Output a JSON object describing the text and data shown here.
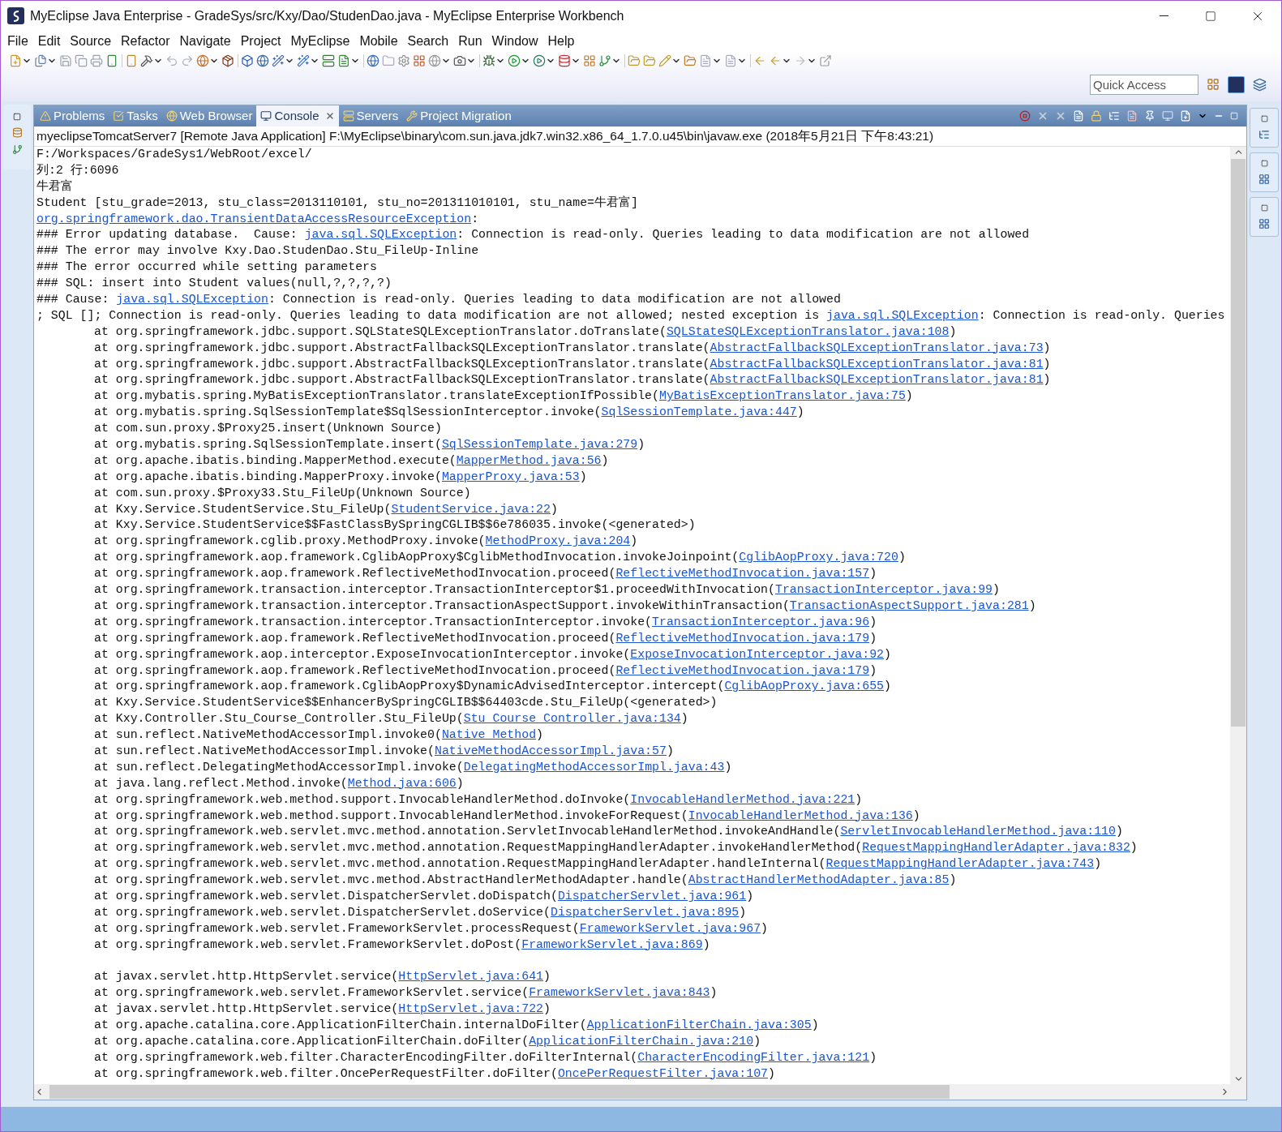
{
  "window": {
    "title": "MyEclipse Java Enterprise - GradeSys/src/Kxy/Dao/StudenDao.java - MyEclipse Enterprise Workbench"
  },
  "menu": [
    "File",
    "Edit",
    "Source",
    "Refactor",
    "Navigate",
    "Project",
    "MyEclipse",
    "Mobile",
    "Search",
    "Run",
    "Window",
    "Help"
  ],
  "quick_access": {
    "placeholder": "Quick Access"
  },
  "tabs": [
    {
      "label": "Problems",
      "selected": false
    },
    {
      "label": "Tasks",
      "selected": false
    },
    {
      "label": "Web Browser",
      "selected": false
    },
    {
      "label": "Console",
      "selected": true
    },
    {
      "label": "Servers",
      "selected": false
    },
    {
      "label": "Project Migration",
      "selected": false
    }
  ],
  "console": {
    "header": "myeclipseTomcatServer7 [Remote Java Application] F:\\MyEclipse\\binary\\com.sun.java.jdk7.win32.x86_64_1.7.0.u45\\bin\\javaw.exe (2018年5月21日 下午8:43:21)",
    "lines": [
      {
        "kind": "plain",
        "parts": [
          {
            "text": "F:/Workspaces/GradeSys1/WebRoot/excel/",
            "link": false
          }
        ]
      },
      {
        "kind": "plain",
        "parts": [
          {
            "text": "列:2 行:6096",
            "link": false
          }
        ]
      },
      {
        "kind": "plain",
        "parts": [
          {
            "text": "牛君富",
            "link": false
          }
        ]
      },
      {
        "kind": "plain",
        "parts": [
          {
            "text": "Student [stu_grade=2013, stu_class=2013110101, stu_no=201311010101, stu_name=牛君富]",
            "link": false
          }
        ]
      },
      {
        "kind": "plain",
        "parts": [
          {
            "text": "org.springframework.dao.TransientDataAccessResourceException",
            "link": true
          },
          {
            "text": ":",
            "link": false
          }
        ]
      },
      {
        "kind": "plain",
        "parts": [
          {
            "text": "### Error updating database.  Cause: ",
            "link": false
          },
          {
            "text": "java.sql.SQLException",
            "link": true
          },
          {
            "text": ": Connection is read-only. Queries leading to data modification are not allowed",
            "link": false
          }
        ]
      },
      {
        "kind": "plain",
        "parts": [
          {
            "text": "### The error may involve Kxy.Dao.StudenDao.Stu_FileUp-Inline",
            "link": false
          }
        ]
      },
      {
        "kind": "plain",
        "parts": [
          {
            "text": "### The error occurred while setting parameters",
            "link": false
          }
        ]
      },
      {
        "kind": "plain",
        "parts": [
          {
            "text": "### SQL: insert into Student values(null,?,?,?,?)",
            "link": false
          }
        ]
      },
      {
        "kind": "plain",
        "parts": [
          {
            "text": "### Cause: ",
            "link": false
          },
          {
            "text": "java.sql.SQLException",
            "link": true
          },
          {
            "text": ": Connection is read-only. Queries leading to data modification are not allowed",
            "link": false
          }
        ]
      },
      {
        "kind": "plain",
        "parts": [
          {
            "text": "; SQL []; Connection is read-only. Queries leading to data modification are not allowed; nested exception is ",
            "link": false
          },
          {
            "text": "java.sql.SQLException",
            "link": true
          },
          {
            "text": ": Connection is read-only. Queries",
            "link": false
          }
        ]
      },
      {
        "kind": "frame",
        "call": "at org.springframework.jdbc.support.SQLStateSQLExceptionTranslator.doTranslate(",
        "link": "SQLStateSQLExceptionTranslator.java:108",
        "close": ")"
      },
      {
        "kind": "frame",
        "call": "at org.springframework.jdbc.support.AbstractFallbackSQLExceptionTranslator.translate(",
        "link": "AbstractFallbackSQLExceptionTranslator.java:73",
        "close": ")"
      },
      {
        "kind": "frame",
        "call": "at org.springframework.jdbc.support.AbstractFallbackSQLExceptionTranslator.translate(",
        "link": "AbstractFallbackSQLExceptionTranslator.java:81",
        "close": ")"
      },
      {
        "kind": "frame",
        "call": "at org.springframework.jdbc.support.AbstractFallbackSQLExceptionTranslator.translate(",
        "link": "AbstractFallbackSQLExceptionTranslator.java:81",
        "close": ")"
      },
      {
        "kind": "frame",
        "call": "at org.mybatis.spring.MyBatisExceptionTranslator.translateExceptionIfPossible(",
        "link": "MyBatisExceptionTranslator.java:75",
        "close": ")"
      },
      {
        "kind": "frame",
        "call": "at org.mybatis.spring.SqlSessionTemplate$SqlSessionInterceptor.invoke(",
        "link": "SqlSessionTemplate.java:447",
        "close": ")"
      },
      {
        "kind": "frame",
        "call": "at com.sun.proxy.$Proxy25.insert(Unknown Source)"
      },
      {
        "kind": "frame",
        "call": "at org.mybatis.spring.SqlSessionTemplate.insert(",
        "link": "SqlSessionTemplate.java:279",
        "close": ")"
      },
      {
        "kind": "frame",
        "call": "at org.apache.ibatis.binding.MapperMethod.execute(",
        "link": "MapperMethod.java:56",
        "close": ")"
      },
      {
        "kind": "frame",
        "call": "at org.apache.ibatis.binding.MapperProxy.invoke(",
        "link": "MapperProxy.java:53",
        "close": ")"
      },
      {
        "kind": "frame",
        "call": "at com.sun.proxy.$Proxy33.Stu_FileUp(Unknown Source)"
      },
      {
        "kind": "frame",
        "call": "at Kxy.Service.StudentService.Stu_FileUp(",
        "link": "StudentService.java:22",
        "close": ")"
      },
      {
        "kind": "frame",
        "call": "at Kxy.Service.StudentService$$FastClassBySpringCGLIB$$6e786035.invoke(<generated>)"
      },
      {
        "kind": "frame",
        "call": "at org.springframework.cglib.proxy.MethodProxy.invoke(",
        "link": "MethodProxy.java:204",
        "close": ")"
      },
      {
        "kind": "frame",
        "call": "at org.springframework.aop.framework.CglibAopProxy$CglibMethodInvocation.invokeJoinpoint(",
        "link": "CglibAopProxy.java:720",
        "close": ")"
      },
      {
        "kind": "frame",
        "call": "at org.springframework.aop.framework.ReflectiveMethodInvocation.proceed(",
        "link": "ReflectiveMethodInvocation.java:157",
        "close": ")"
      },
      {
        "kind": "frame",
        "call": "at org.springframework.transaction.interceptor.TransactionInterceptor$1.proceedWithInvocation(",
        "link": "TransactionInterceptor.java:99",
        "close": ")"
      },
      {
        "kind": "frame",
        "call": "at org.springframework.transaction.interceptor.TransactionAspectSupport.invokeWithinTransaction(",
        "link": "TransactionAspectSupport.java:281",
        "close": ")"
      },
      {
        "kind": "frame",
        "call": "at org.springframework.transaction.interceptor.TransactionInterceptor.invoke(",
        "link": "TransactionInterceptor.java:96",
        "close": ")"
      },
      {
        "kind": "frame",
        "call": "at org.springframework.aop.framework.ReflectiveMethodInvocation.proceed(",
        "link": "ReflectiveMethodInvocation.java:179",
        "close": ")"
      },
      {
        "kind": "frame",
        "call": "at org.springframework.aop.interceptor.ExposeInvocationInterceptor.invoke(",
        "link": "ExposeInvocationInterceptor.java:92",
        "close": ")"
      },
      {
        "kind": "frame",
        "call": "at org.springframework.aop.framework.ReflectiveMethodInvocation.proceed(",
        "link": "ReflectiveMethodInvocation.java:179",
        "close": ")"
      },
      {
        "kind": "frame",
        "call": "at org.springframework.aop.framework.CglibAopProxy$DynamicAdvisedInterceptor.intercept(",
        "link": "CglibAopProxy.java:655",
        "close": ")"
      },
      {
        "kind": "frame",
        "call": "at Kxy.Service.StudentService$$EnhancerBySpringCGLIB$$64403cde.Stu_FileUp(<generated>)"
      },
      {
        "kind": "frame",
        "call": "at Kxy.Controller.Stu_Course_Controller.Stu_FileUp(",
        "link": "Stu_Course_Controller.java:134",
        "close": ")"
      },
      {
        "kind": "frame",
        "call": "at sun.reflect.NativeMethodAccessorImpl.invoke0(",
        "link": "Native Method",
        "close": ")"
      },
      {
        "kind": "frame",
        "call": "at sun.reflect.NativeMethodAccessorImpl.invoke(",
        "link": "NativeMethodAccessorImpl.java:57",
        "close": ")"
      },
      {
        "kind": "frame",
        "call": "at sun.reflect.DelegatingMethodAccessorImpl.invoke(",
        "link": "DelegatingMethodAccessorImpl.java:43",
        "close": ")"
      },
      {
        "kind": "frame",
        "call": "at java.lang.reflect.Method.invoke(",
        "link": "Method.java:606",
        "close": ")"
      },
      {
        "kind": "frame",
        "call": "at org.springframework.web.method.support.InvocableHandlerMethod.doInvoke(",
        "link": "InvocableHandlerMethod.java:221",
        "close": ")"
      },
      {
        "kind": "frame",
        "call": "at org.springframework.web.method.support.InvocableHandlerMethod.invokeForRequest(",
        "link": "InvocableHandlerMethod.java:136",
        "close": ")"
      },
      {
        "kind": "frame",
        "call": "at org.springframework.web.servlet.mvc.method.annotation.ServletInvocableHandlerMethod.invokeAndHandle(",
        "link": "ServletInvocableHandlerMethod.java:110",
        "close": ")"
      },
      {
        "kind": "frame",
        "call": "at org.springframework.web.servlet.mvc.method.annotation.RequestMappingHandlerAdapter.invokeHandlerMethod(",
        "link": "RequestMappingHandlerAdapter.java:832",
        "close": ")"
      },
      {
        "kind": "frame",
        "call": "at org.springframework.web.servlet.mvc.method.annotation.RequestMappingHandlerAdapter.handleInternal(",
        "link": "RequestMappingHandlerAdapter.java:743",
        "close": ")"
      },
      {
        "kind": "frame",
        "call": "at org.springframework.web.servlet.mvc.method.AbstractHandlerMethodAdapter.handle(",
        "link": "AbstractHandlerMethodAdapter.java:85",
        "close": ")"
      },
      {
        "kind": "frame",
        "call": "at org.springframework.web.servlet.DispatcherServlet.doDispatch(",
        "link": "DispatcherServlet.java:961",
        "close": ")"
      },
      {
        "kind": "frame",
        "call": "at org.springframework.web.servlet.DispatcherServlet.doService(",
        "link": "DispatcherServlet.java:895",
        "close": ")"
      },
      {
        "kind": "frame",
        "call": "at org.springframework.web.servlet.FrameworkServlet.processRequest(",
        "link": "FrameworkServlet.java:967",
        "close": ")"
      },
      {
        "kind": "frame",
        "call": "at org.springframework.web.servlet.FrameworkServlet.doPost(",
        "link": "FrameworkServlet.java:869",
        "close": ")"
      },
      {
        "kind": "blank"
      },
      {
        "kind": "frame",
        "call": "at javax.servlet.http.HttpServlet.service(",
        "link": "HttpServlet.java:641",
        "close": ")"
      },
      {
        "kind": "frame",
        "call": "at org.springframework.web.servlet.FrameworkServlet.service(",
        "link": "FrameworkServlet.java:843",
        "close": ")"
      },
      {
        "kind": "frame",
        "call": "at javax.servlet.http.HttpServlet.service(",
        "link": "HttpServlet.java:722",
        "close": ")"
      },
      {
        "kind": "frame",
        "call": "at org.apache.catalina.core.ApplicationFilterChain.internalDoFilter(",
        "link": "ApplicationFilterChain.java:305",
        "close": ")"
      },
      {
        "kind": "frame",
        "call": "at org.apache.catalina.core.ApplicationFilterChain.doFilter(",
        "link": "ApplicationFilterChain.java:210",
        "close": ")"
      },
      {
        "kind": "frame",
        "call": "at org.springframework.web.filter.CharacterEncodingFilter.doFilterInternal(",
        "link": "CharacterEncodingFilter.java:121",
        "close": ")"
      },
      {
        "kind": "frame",
        "call": "at org.springframework.web.filter.OncePerRequestFilter.doFilter(",
        "link": "OncePerRequestFilter.java:107",
        "close": ")"
      }
    ]
  }
}
